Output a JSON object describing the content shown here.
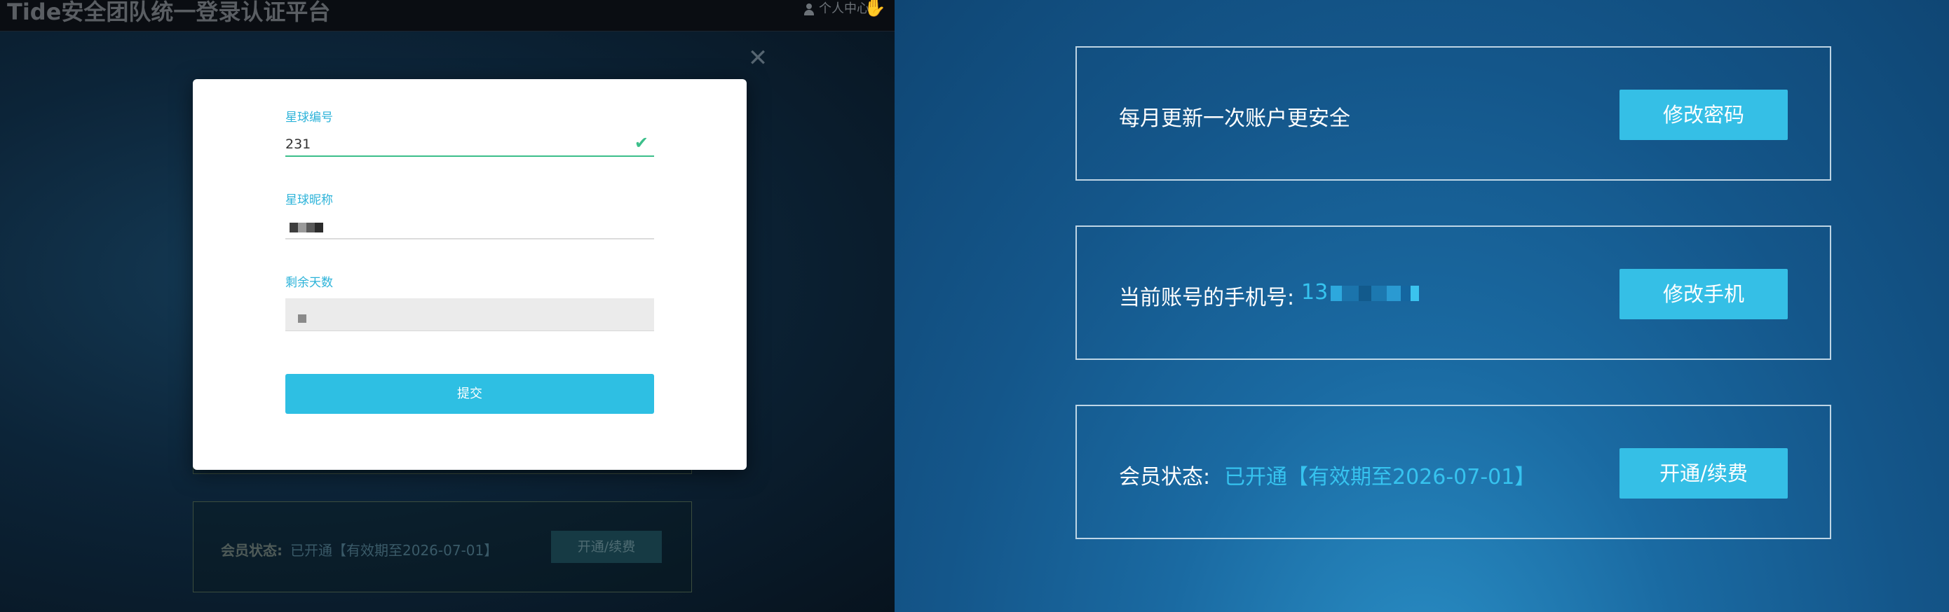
{
  "left": {
    "app_title": "Tide安全团队统一登录认证平台",
    "user_center": "个人中心",
    "modal": {
      "fields": [
        {
          "label": "星球编号",
          "value": "231"
        },
        {
          "label": "星球昵称",
          "value": ""
        },
        {
          "label": "剩余天数",
          "value": ""
        }
      ],
      "submit_label": "提交"
    },
    "background": {
      "member_label": "会员状态:",
      "member_value": "已开通【有效期至2026-07-01】",
      "renew_label": "开通/续费"
    }
  },
  "right": {
    "cards": [
      {
        "label": "每月更新一次账户更安全",
        "value": "",
        "button": "修改密码"
      },
      {
        "label": "当前账号的手机号:",
        "value": "13",
        "button": "修改手机"
      },
      {
        "label": "会员状态:",
        "value": "已开通【有效期至2026-07-01】",
        "button": "开通/续费"
      }
    ]
  },
  "colors": {
    "accent": "#2ebfe3",
    "valid": "#3cbf8a",
    "link_text": "#36c3ef"
  }
}
